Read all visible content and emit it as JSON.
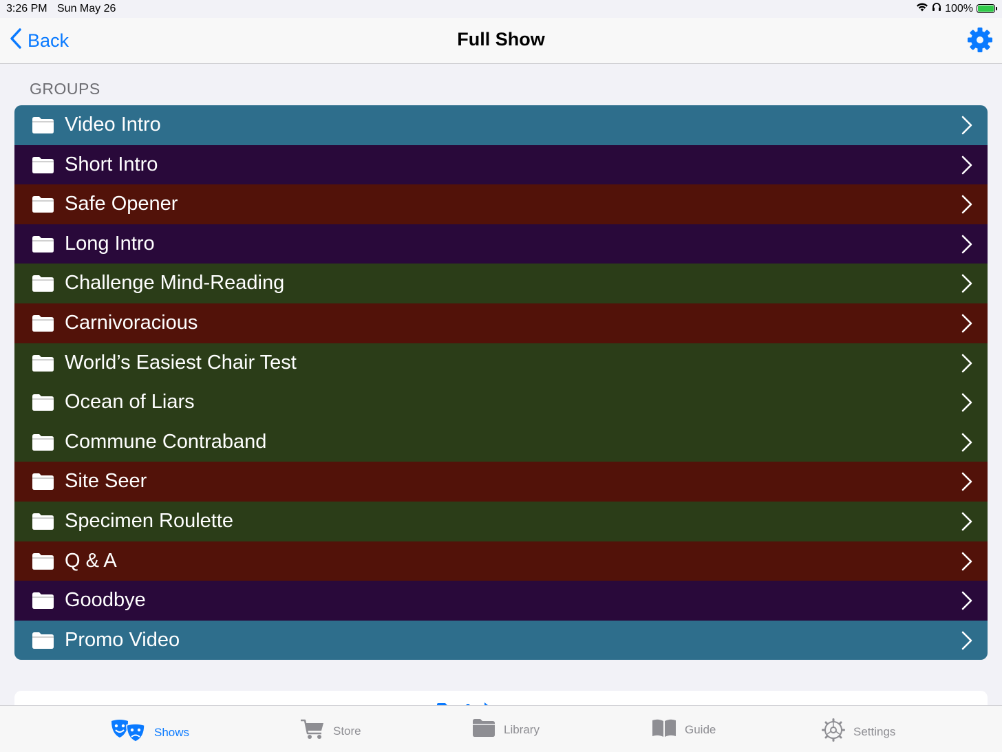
{
  "status": {
    "time": "3:26 PM",
    "date": "Sun May 26",
    "battery": "100%"
  },
  "nav": {
    "back_label": "Back",
    "title": "Full Show"
  },
  "section_header": "GROUPS",
  "groups": [
    {
      "label": "Video Intro",
      "color": "#2e6e8c"
    },
    {
      "label": "Short Intro",
      "color": "#29093a"
    },
    {
      "label": "Safe Opener",
      "color": "#521209"
    },
    {
      "label": "Long Intro",
      "color": "#29093a"
    },
    {
      "label": "Challenge Mind-Reading",
      "color": "#2b3d18"
    },
    {
      "label": "Carnivoracious",
      "color": "#521209"
    },
    {
      "label": "World’s Easiest Chair Test",
      "color": "#2b3d18"
    },
    {
      "label": "Ocean of Liars",
      "color": "#2b3d18"
    },
    {
      "label": "Commune Contraband",
      "color": "#2b3d18"
    },
    {
      "label": "Site Seer",
      "color": "#521209"
    },
    {
      "label": "Specimen Roulette",
      "color": "#2b3d18"
    },
    {
      "label": "Q & A",
      "color": "#521209"
    },
    {
      "label": "Goodbye",
      "color": "#29093a"
    },
    {
      "label": "Promo Video",
      "color": "#2e6e8c"
    }
  ],
  "tabs": [
    {
      "label": "Shows",
      "icon": "theater-masks-icon",
      "active": true
    },
    {
      "label": "Store",
      "icon": "cart-icon",
      "active": false
    },
    {
      "label": "Library",
      "icon": "folder-icon",
      "active": false
    },
    {
      "label": "Guide",
      "icon": "book-icon",
      "active": false
    },
    {
      "label": "Settings",
      "icon": "gear-icon",
      "active": false
    }
  ],
  "colors": {
    "accent": "#0a7aff",
    "inactive_tab": "#8e8e93",
    "background": "#f2f2f7"
  }
}
